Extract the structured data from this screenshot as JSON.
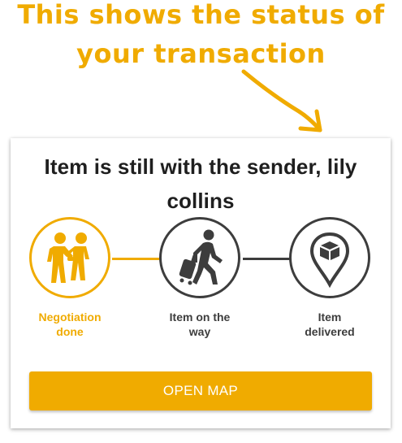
{
  "annotation": {
    "line1": "This shows the status of",
    "line2": "your transaction",
    "color": "#f0ab00",
    "pointer_icon": "hand-drawn-arrow-icon"
  },
  "card": {
    "title": "Item is still with the sender, lily collins",
    "steps": [
      {
        "label_line1": "Negotiation",
        "label_line2": "done",
        "icon": "handshake-icon",
        "state": "done"
      },
      {
        "label_line1": "Item on the",
        "label_line2": "way",
        "icon": "traveler-with-luggage-icon",
        "state": "pending"
      },
      {
        "label_line1": "Item",
        "label_line2": "delivered",
        "icon": "package-location-pin-icon",
        "state": "pending"
      }
    ],
    "button_label": "OPEN MAP"
  },
  "colors": {
    "accent": "#f0ab00",
    "inactive": "#3d3d3d",
    "text": "#1f1f1f"
  }
}
